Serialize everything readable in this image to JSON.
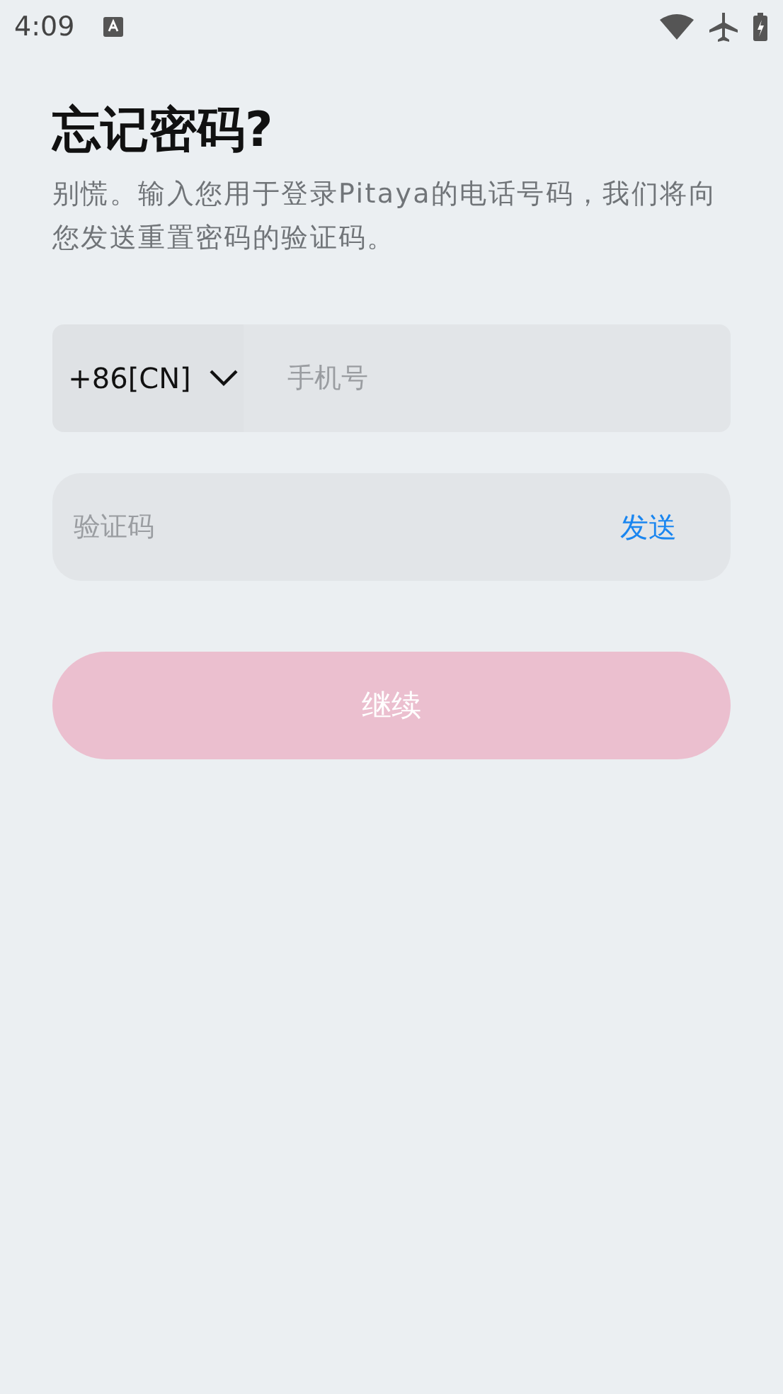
{
  "status_bar": {
    "time": "4:09"
  },
  "title": "忘记密码?",
  "subtitle": "别慌。输入您用于登录Pitaya的电话号码，我们将向您发送重置密码的验证码。",
  "phone": {
    "country_code": "+86[CN]",
    "placeholder": "手机号"
  },
  "code": {
    "placeholder": "验证码",
    "send_label": "发送"
  },
  "continue_button": {
    "label": "继续",
    "disabled": true
  }
}
